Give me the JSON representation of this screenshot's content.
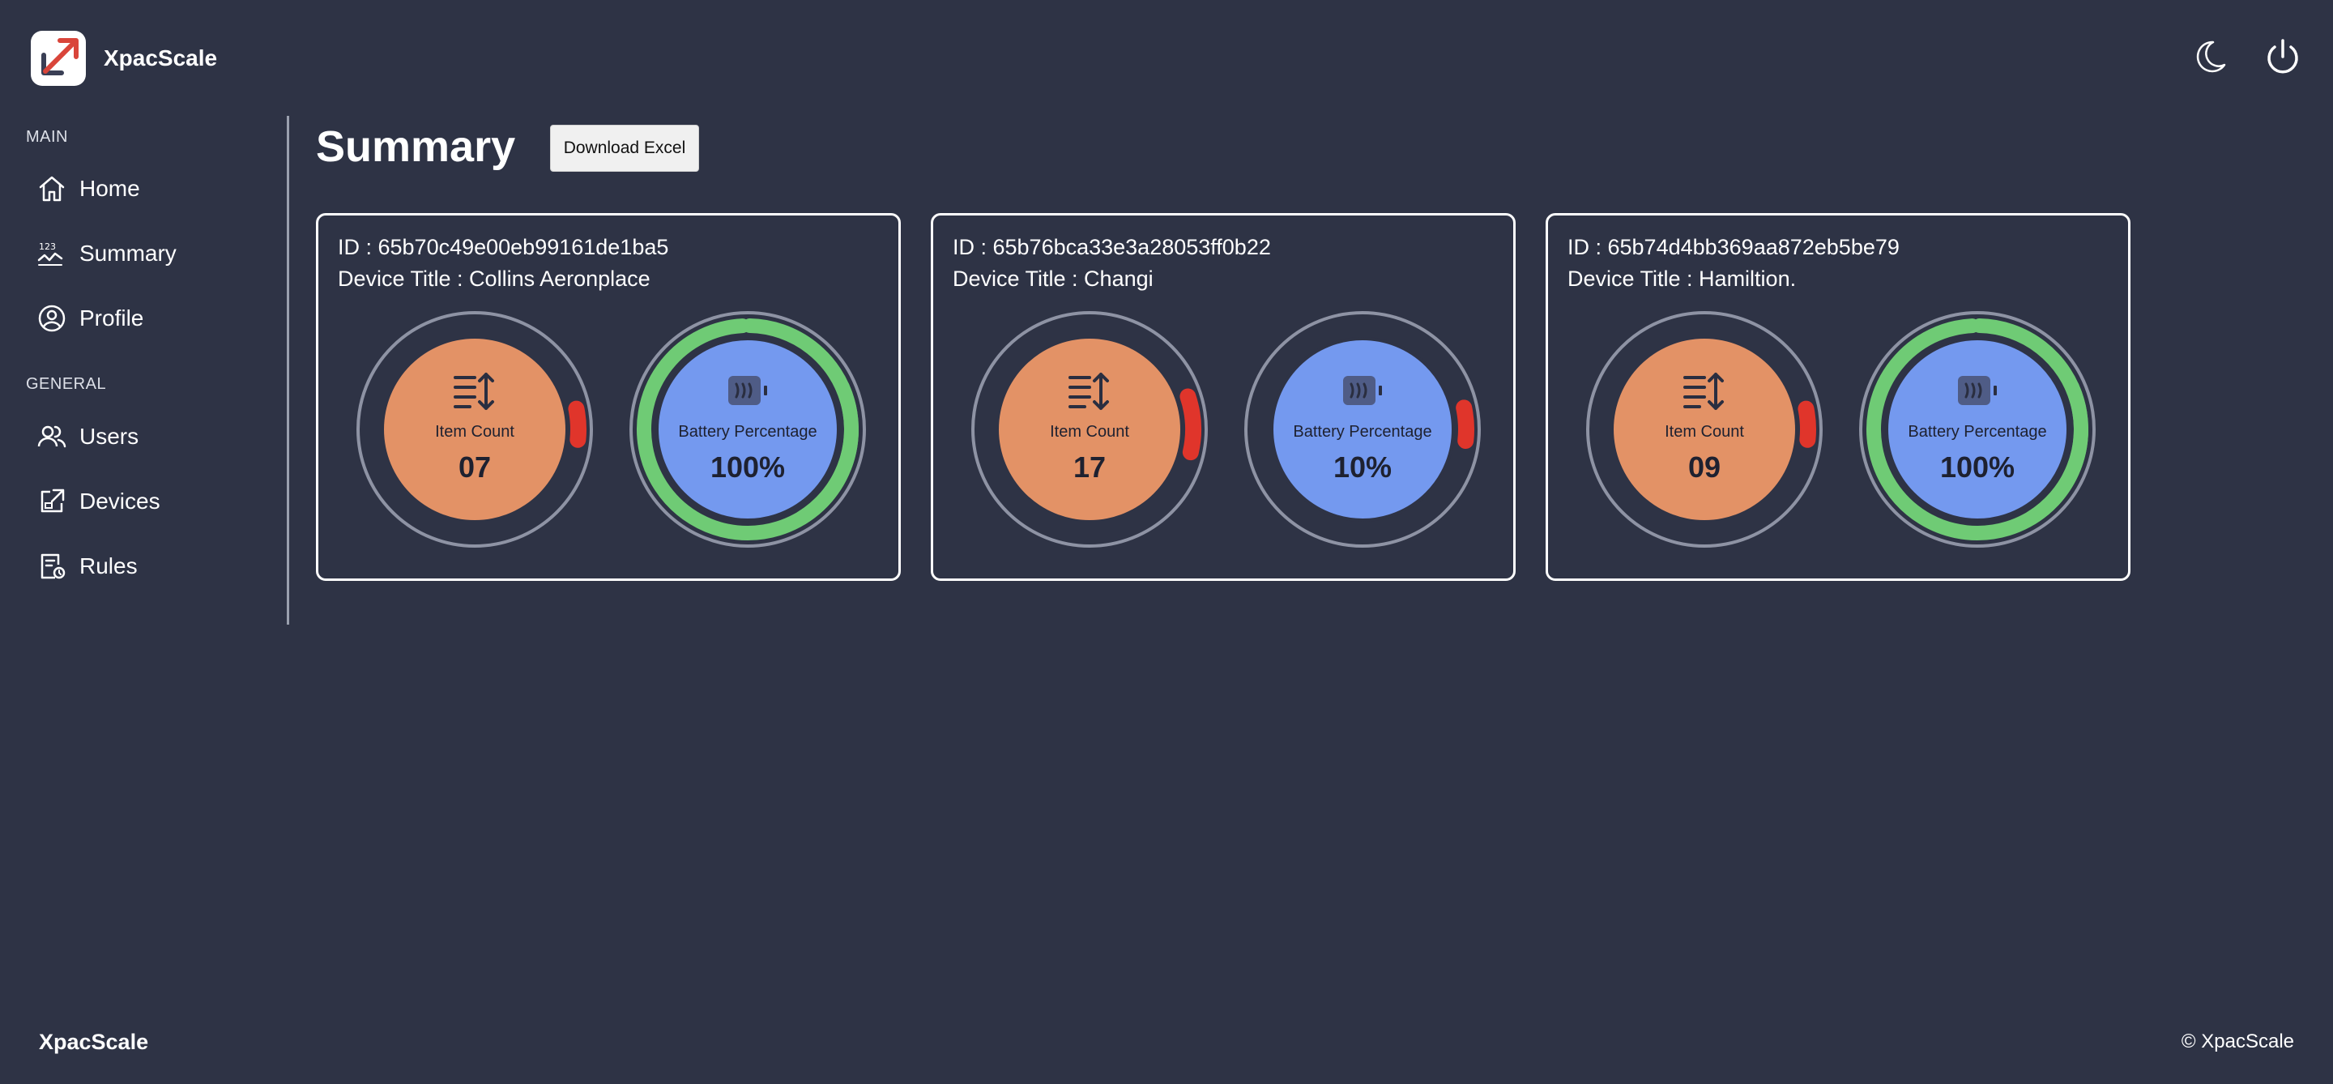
{
  "app": {
    "brand": "XpacScale"
  },
  "sidebar": {
    "sections": [
      {
        "label": "MAIN",
        "items": [
          {
            "label": "Home",
            "icon": "home-icon"
          },
          {
            "label": "Summary",
            "icon": "numbers-chart-icon"
          },
          {
            "label": "Profile",
            "icon": "user-circle-icon"
          }
        ]
      },
      {
        "label": "GENERAL",
        "items": [
          {
            "label": "Users",
            "icon": "users-icon"
          },
          {
            "label": "Devices",
            "icon": "devices-icon"
          },
          {
            "label": "Rules",
            "icon": "rules-icon"
          }
        ]
      }
    ]
  },
  "main": {
    "title": "Summary",
    "download_label": "Download Excel",
    "cards": [
      {
        "id_line": "ID : 65b70c49e00eb99161de1ba5",
        "title_line": "Device Title : Collins Aeronplace",
        "item_count": {
          "label": "Item Count",
          "value": "07",
          "fraction": 0.07
        },
        "battery": {
          "label": "Battery Percentage",
          "value": "100%",
          "fraction": 1.0
        }
      },
      {
        "id_line": "ID : 65b76bca33e3a28053ff0b22",
        "title_line": "Device Title : Changi",
        "item_count": {
          "label": "Item Count",
          "value": "17",
          "fraction": 0.17
        },
        "battery": {
          "label": "Battery Percentage",
          "value": "10%",
          "fraction": 0.1
        }
      },
      {
        "id_line": "ID : 65b74d4bb369aa872eb5be79",
        "title_line": "Device Title : Hamiltion.",
        "item_count": {
          "label": "Item Count",
          "value": "09",
          "fraction": 0.09
        },
        "battery": {
          "label": "Battery Percentage",
          "value": "100%",
          "fraction": 1.0
        }
      }
    ]
  },
  "footer": {
    "brand": "XpacScale",
    "copyright": "© XpacScale"
  },
  "colors": {
    "background": "#2e3345",
    "item_fill": "#e39266",
    "battery_fill": "#7499ef",
    "low_arc": "#e0352b",
    "full_arc": "#6fcb75",
    "logo_accent": "#d9453a"
  },
  "icons": {
    "header_theme": "moon-icon",
    "header_logout": "power-icon",
    "item": "sort-list-icon",
    "battery": "battery-icon"
  }
}
